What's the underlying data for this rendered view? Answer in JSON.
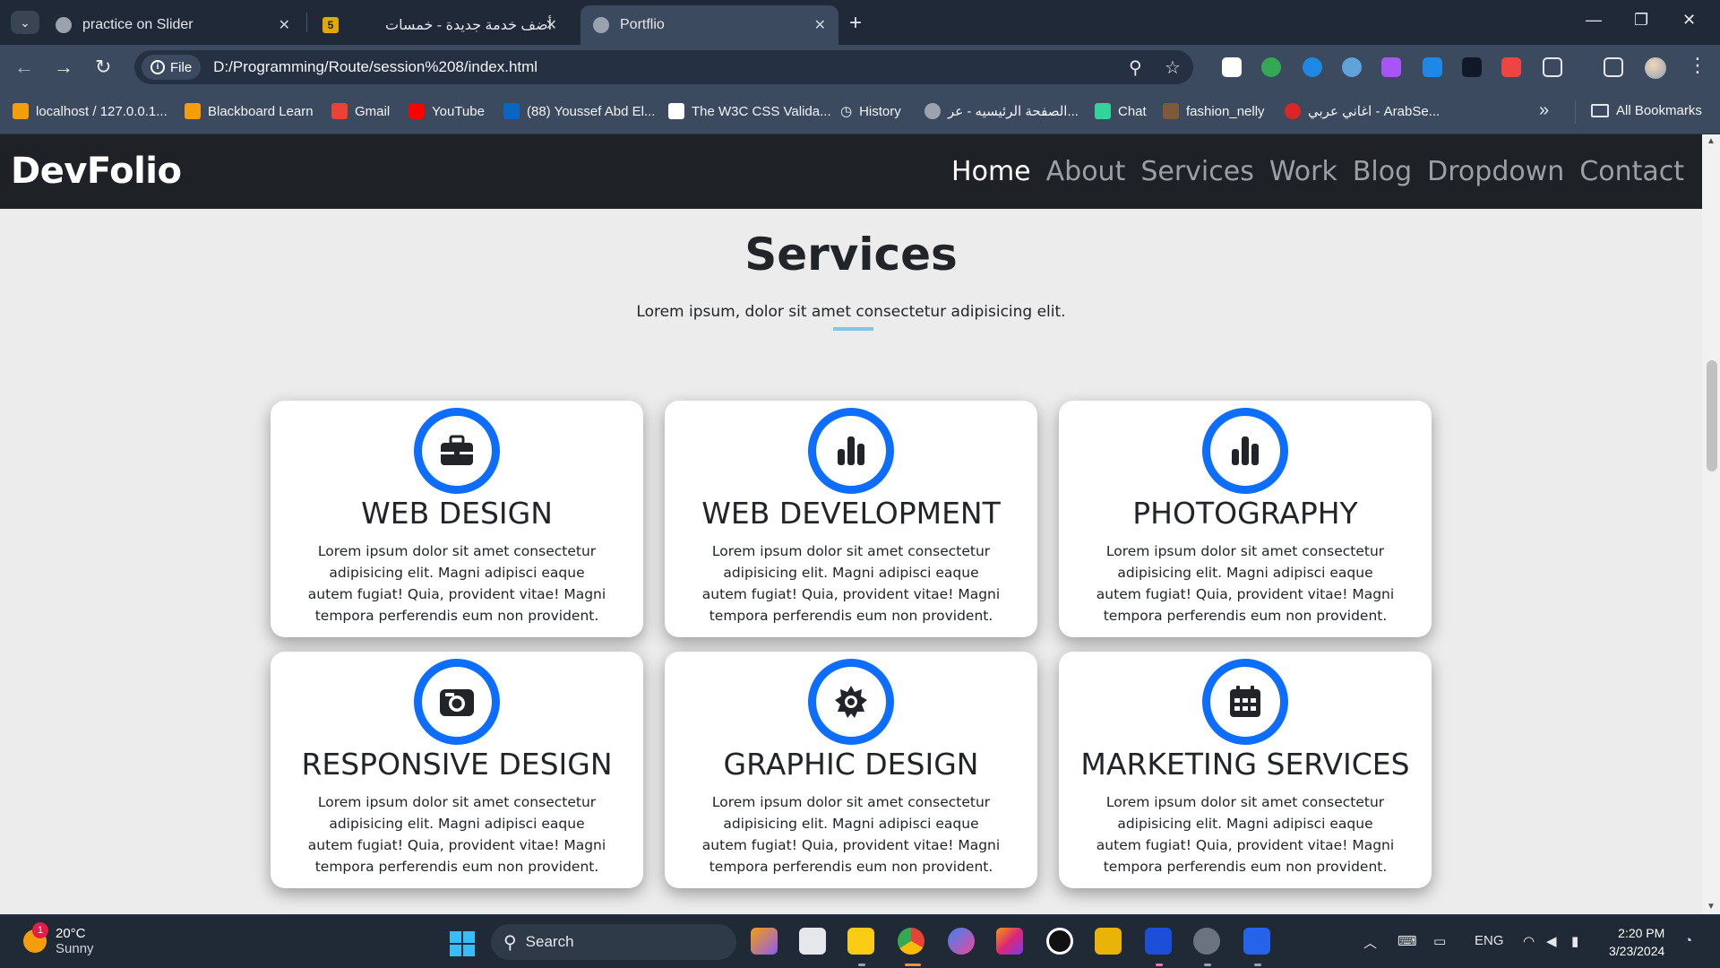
{
  "browser": {
    "tabs": [
      {
        "title": "practice on Slider",
        "favicon": "globe-icon",
        "active": false
      },
      {
        "title": "أضف خدمة جديدة - خمسات",
        "favicon": "khamsat-icon",
        "active": false
      },
      {
        "title": "Portflio",
        "favicon": "globe-icon",
        "active": true
      }
    ],
    "url_scheme_label": "File",
    "url": "D:/Programming/Route/session%208/index.html",
    "bookmarks": [
      "localhost / 127.0.0.1...",
      "Blackboard Learn",
      "Gmail",
      "YouTube",
      "(88) Youssef Abd El...",
      "The W3C CSS Valida...",
      "History",
      "الصفحة الرئيسيه - عر...",
      "Chat",
      "fashion_nelly",
      "اغاني عربي - ArabSe..."
    ],
    "all_bookmarks": "All Bookmarks"
  },
  "site": {
    "brand": "DevFolio",
    "nav": [
      "Home",
      "About",
      "Services",
      "Work",
      "Blog",
      "Dropdown",
      "Contact"
    ],
    "nav_active": "Home",
    "section_title": "Services",
    "section_subtitle": "Lorem ipsum, dolor sit amet consectetur adipisicing elit.",
    "cards": [
      {
        "title": "Web Design",
        "icon": "briefcase-icon",
        "text": "Lorem ipsum dolor sit amet consectetur adipisicing elit. Magni adipisci eaque autem fugiat! Quia, provident vitae! Magni tempora perferendis eum non provident."
      },
      {
        "title": "Web Development",
        "icon": "bar-chart-icon",
        "text": "Lorem ipsum dolor sit amet consectetur adipisicing elit. Magni adipisci eaque autem fugiat! Quia, provident vitae! Magni tempora perferendis eum non provident."
      },
      {
        "title": "Photography",
        "icon": "bar-chart-icon",
        "text": "Lorem ipsum dolor sit amet consectetur adipisicing elit. Magni adipisci eaque autem fugiat! Quia, provident vitae! Magni tempora perferendis eum non provident."
      },
      {
        "title": "Responsive Design",
        "icon": "camera-icon",
        "text": "Lorem ipsum dolor sit amet consectetur adipisicing elit. Magni adipisci eaque autem fugiat! Quia, provident vitae! Magni tempora perferendis eum non provident."
      },
      {
        "title": "Graphic Design",
        "icon": "gear-icon",
        "text": "Lorem ipsum dolor sit amet consectetur adipisicing elit. Magni adipisci eaque autem fugiat! Quia, provident vitae! Magni tempora perferendis eum non provident."
      },
      {
        "title": "Marketing Services",
        "icon": "calendar-icon",
        "text": "Lorem ipsum dolor sit amet consectetur adipisicing elit. Magni adipisci eaque autem fugiat! Quia, provident vitae! Magni tempora perferendis eum non provident."
      }
    ]
  },
  "taskbar": {
    "weather_temp": "20°C",
    "weather_desc": "Sunny",
    "weather_badge": "1",
    "search_placeholder": "Search",
    "language": "ENG",
    "time": "2:20 PM",
    "date": "3/23/2024"
  },
  "colors": {
    "accent": "#0d6efd",
    "navbar": "#1e2125",
    "page_bg": "#ececec",
    "underline": "#7ec8e3"
  }
}
